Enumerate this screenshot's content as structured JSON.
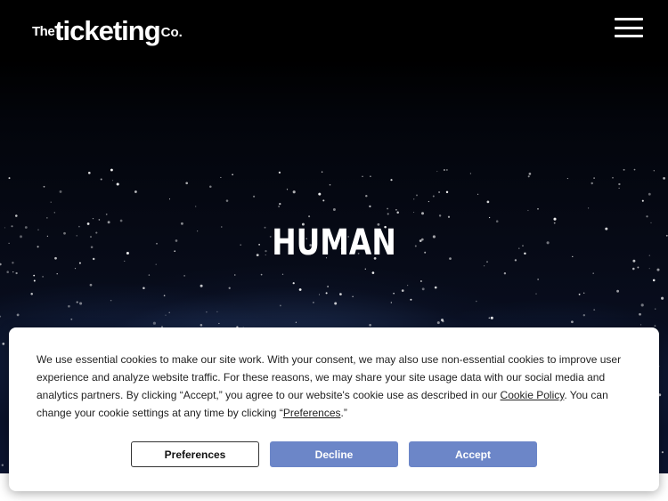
{
  "header": {
    "logo": {
      "the": "The",
      "main": "ticketing",
      "co": "Co."
    },
    "menu_icon": "hamburger-menu-icon"
  },
  "hero": {
    "title": "HUMAN"
  },
  "cookie_banner": {
    "text_part1": "We use essential cookies to make our site work. With your consent, we may also use non-essential cookies to improve user experience and analyze website traffic. For these reasons, we may share your site usage data with our social media and analytics partners. By clicking “Accept,” you agree to our website's cookie use as described in our ",
    "cookie_policy_link": "Cookie Policy",
    "text_part2": ". You can change your cookie settings at any time by clicking “",
    "preferences_link": "Preferences",
    "text_part3": ".”",
    "buttons": {
      "preferences": "Preferences",
      "decline": "Decline",
      "accept": "Accept"
    }
  },
  "colors": {
    "accent": "#6c86c8",
    "header_bg": "#000000"
  }
}
